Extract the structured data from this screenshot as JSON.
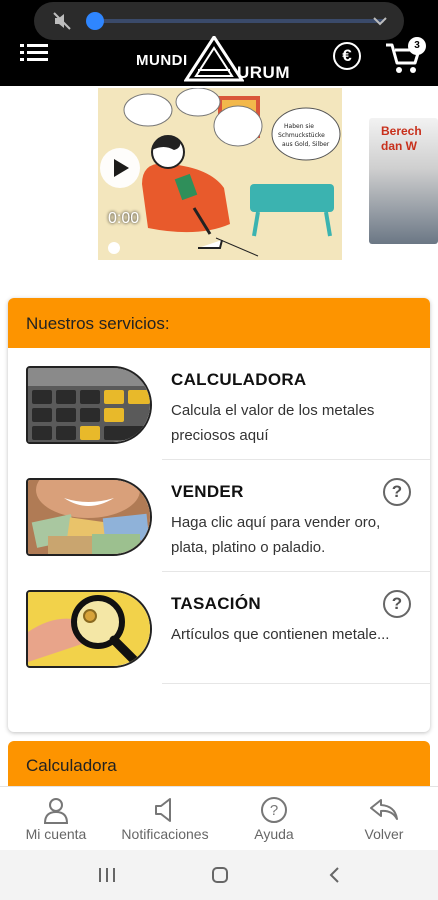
{
  "header": {
    "logo_left": "MUNDI",
    "logo_right": "URUM",
    "currency_symbol": "€",
    "cart_count": "3"
  },
  "video": {
    "time": "0:00",
    "bubble_text": "¿Haben sie Schmuckstücke aus Gold, Silber oder Platin?",
    "side_card_line1": "Berech",
    "side_card_line2": "dan W"
  },
  "services": {
    "title": "Nuestros servicios:",
    "items": [
      {
        "title": "CALCULADORA",
        "desc": "Calcula el valor de los metales preciosos aquí",
        "has_help": false
      },
      {
        "title": "VENDER",
        "desc": "Haga clic aquí para vender oro, plata, platino o paladio.",
        "has_help": true
      },
      {
        "title": "TASACIÓN",
        "desc": "Artículos que contienen metale...",
        "has_help": true
      }
    ],
    "help_symbol": "?"
  },
  "calculadora_section": {
    "title": "Calculadora"
  },
  "bottom_nav": [
    {
      "label": "Mi cuenta",
      "icon": "user-icon"
    },
    {
      "label": "Notificaciones",
      "icon": "speaker-icon"
    },
    {
      "label": "Ayuda",
      "icon": "help-circle-icon"
    },
    {
      "label": "Volver",
      "icon": "reply-back-icon"
    }
  ],
  "colors": {
    "accent": "#fd9400",
    "header_bg": "#000000",
    "volume_knob": "#2f86ff"
  }
}
